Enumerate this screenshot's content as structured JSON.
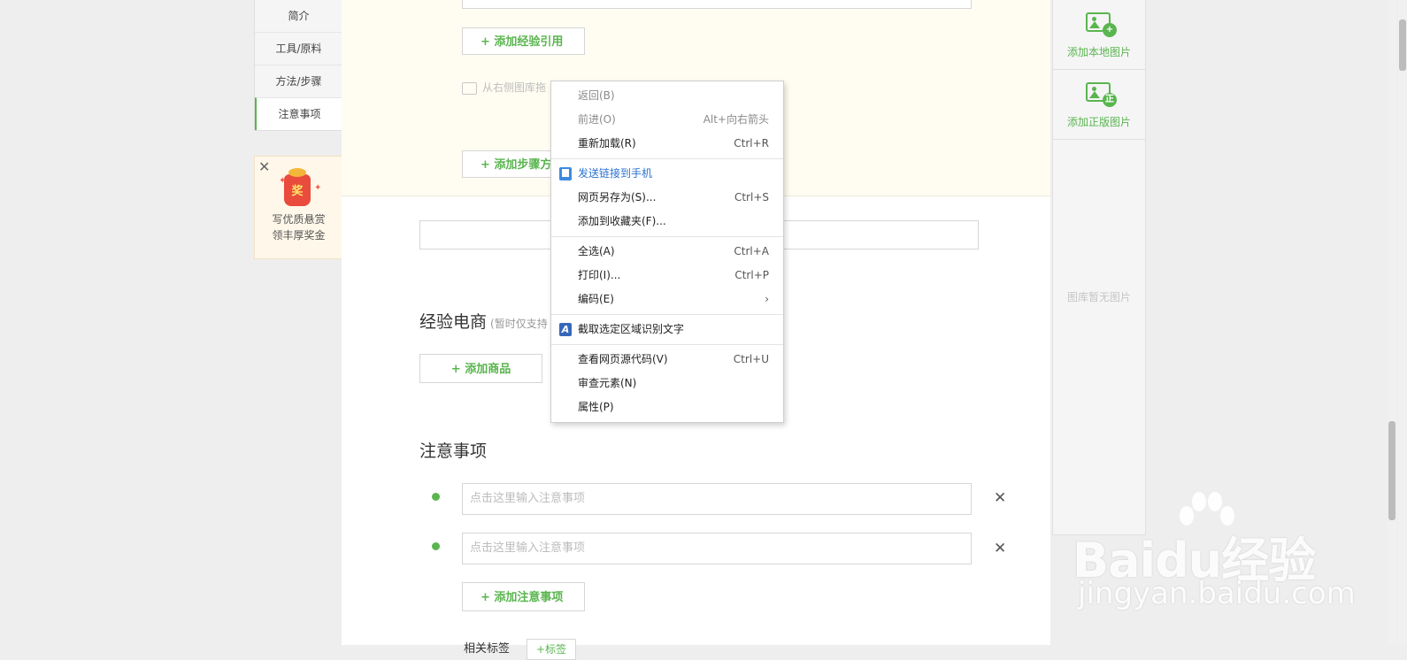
{
  "left_nav": {
    "items": [
      {
        "label": "简介"
      },
      {
        "label": "工具/原料"
      },
      {
        "label": "方法/步骤"
      },
      {
        "label": "注意事项"
      }
    ]
  },
  "reward": {
    "bag_text": "奖",
    "line1": "写优质悬赏",
    "line2": "领丰厚奖金"
  },
  "editor": {
    "add_ref_button": "+ 添加经验引用",
    "image_hint": "从右侧图库拖",
    "add_step_button": "+ 添加步骤方",
    "ecommerce_title": "经验电商",
    "ecommerce_note": "(暂时仅支持",
    "add_product_button": "+ 添加商品",
    "notes_title": "注意事项",
    "note_placeholder": "点击这里输入注意事项",
    "add_note_button": "+ 添加注意事项",
    "tags_label": "相关标签",
    "tag_button": "+标签"
  },
  "right_panel": {
    "local_image": "添加本地图片",
    "licensed_image": "添加正版图片",
    "licensed_badge": "正",
    "empty_text": "图库暂无图片"
  },
  "context_menu": {
    "back": "返回(B)",
    "forward": "前进(O)",
    "forward_shortcut": "Alt+向右箭头",
    "reload": "重新加载(R)",
    "reload_shortcut": "Ctrl+R",
    "send_to_phone": "发送链接到手机",
    "save_as": "网页另存为(S)...",
    "save_as_shortcut": "Ctrl+S",
    "add_favorite": "添加到收藏夹(F)...",
    "select_all": "全选(A)",
    "select_all_shortcut": "Ctrl+A",
    "print": "打印(I)...",
    "print_shortcut": "Ctrl+P",
    "encoding": "编码(E)",
    "ocr": "截取选定区域识别文字",
    "view_source": "查看网页源代码(V)",
    "view_source_shortcut": "Ctrl+U",
    "inspect": "审查元素(N)",
    "properties": "属性(P)"
  },
  "watermark": {
    "brand": "Baidu经验",
    "url": "jingyan.baidu.com"
  },
  "colors": {
    "accent": "#5ab54f",
    "cream": "#fffdf1",
    "link": "#2a73d2"
  }
}
